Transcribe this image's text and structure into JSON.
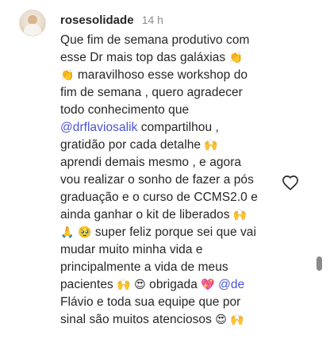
{
  "comment": {
    "username": "rosesolidade",
    "time": "14 h",
    "lines": [
      {
        "text": "Que fim de semana produtivo com",
        "emoji": ""
      },
      {
        "text": "esse Dr mais top das galáxias",
        "emoji": "👏"
      },
      {
        "text": "maravilhoso esse workshop do",
        "emoji_before": "👏"
      },
      {
        "text": "fim de semana , quero agradecer"
      },
      {
        "text": "todo conhecimento que"
      },
      {
        "mention": "@drflaviosalik",
        "text": " compartilhou ,"
      },
      {
        "text": "gratidão por cada detalhe",
        "emoji": "🙌"
      },
      {
        "text": "aprendi demais mesmo , e agora"
      },
      {
        "text": "vou realizar o sonho de fazer a pós"
      },
      {
        "text": "graduação e o curso de CCMS2.0 e"
      },
      {
        "text": "ainda ganhar o kit de liberados",
        "emoji": "🙌"
      },
      {
        "emoji_before": "🙏 🥹",
        "text": " super feliz porque sei que vai"
      },
      {
        "text": "mudar muito minha vida e"
      },
      {
        "text": "principalmente a vida de meus"
      },
      {
        "text": "pacientes",
        "emoji": "🙌 😍",
        "text2": " obrigada ",
        "emoji2": "💖",
        "mention": " @de"
      },
      {
        "text": "Flávio e toda sua equipe que por"
      },
      {
        "text": "sinal são muitos atenciosos",
        "emoji": "😍 🙌"
      }
    ]
  },
  "icons": {
    "like": "heart-outline-icon",
    "avatar": "profile-photo"
  },
  "colors": {
    "mention": "#4a54d6",
    "time": "#8e8e8e",
    "text": "#262626"
  }
}
